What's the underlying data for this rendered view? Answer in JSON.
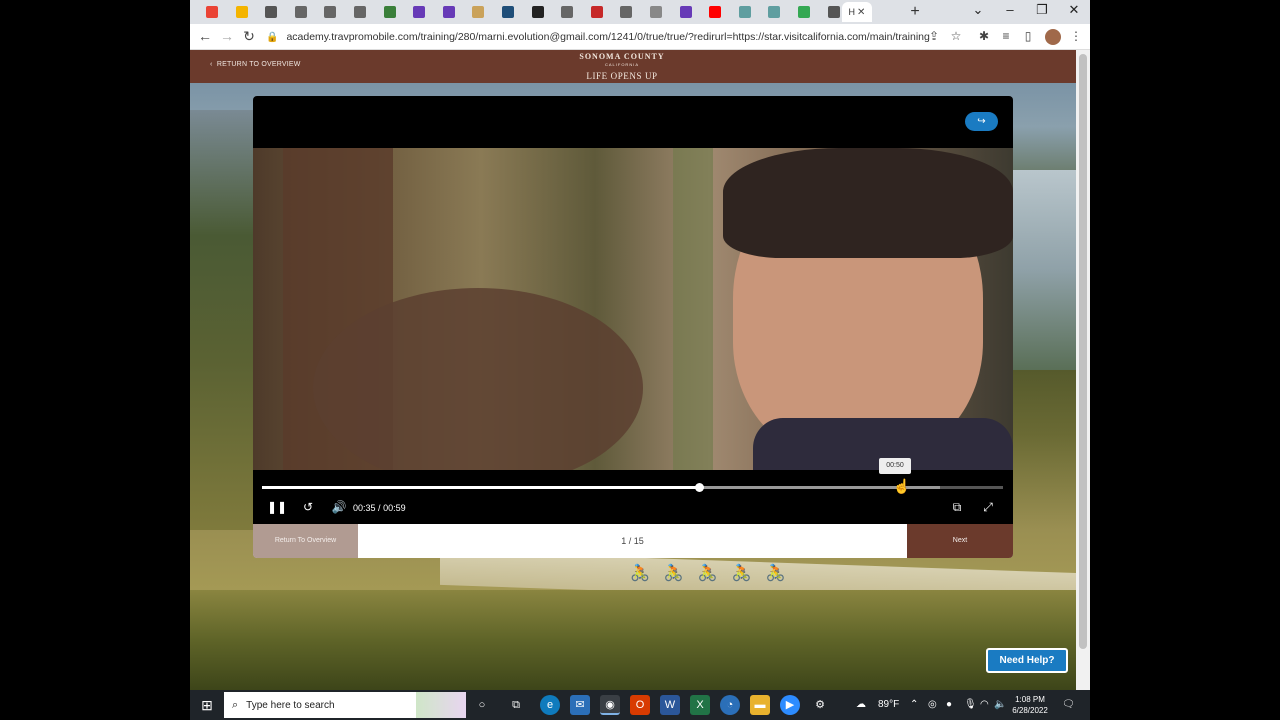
{
  "browser": {
    "tabs": [
      {
        "icon": "gmail-icon",
        "color": "#ea4335"
      },
      {
        "icon": "slides-icon",
        "color": "#f4b400"
      },
      {
        "icon": "web-icon",
        "color": "#555555"
      },
      {
        "icon": "globe-icon",
        "color": "#666666"
      },
      {
        "icon": "globe-icon",
        "color": "#666666"
      },
      {
        "icon": "globe-icon",
        "color": "#666666"
      },
      {
        "icon": "web-icon",
        "color": "#3a7f3a"
      },
      {
        "icon": "forms-icon",
        "color": "#673ab7"
      },
      {
        "icon": "forms-icon",
        "color": "#673ab7"
      },
      {
        "icon": "web-icon",
        "color": "#caa25a"
      },
      {
        "icon": "web-icon",
        "color": "#1f4e79"
      },
      {
        "icon": "web-icon",
        "color": "#222222"
      },
      {
        "icon": "globe-icon",
        "color": "#666666"
      },
      {
        "icon": "web-icon",
        "color": "#c62828"
      },
      {
        "icon": "globe-icon",
        "color": "#666666"
      },
      {
        "icon": "web-icon",
        "color": "#888888"
      },
      {
        "icon": "forms-icon",
        "color": "#673ab7"
      },
      {
        "icon": "youtube-icon",
        "color": "#ff0000"
      },
      {
        "icon": "loading-icon",
        "color": "#5f9ea0"
      },
      {
        "icon": "loading-icon",
        "color": "#5f9ea0"
      },
      {
        "icon": "web-icon",
        "color": "#34a853"
      },
      {
        "icon": "globe-icon",
        "color": "#555555"
      }
    ],
    "active_tab_label": "H",
    "url": "academy.travpromobile.com/training/280/marni.evolution@gmail.com/1241/0/true/true/?redirurl=https://star.visitcalifornia.com/main/training"
  },
  "site": {
    "return_link": "RETURN TO OVERVIEW",
    "brand_line1": "SONOMA COUNTY",
    "brand_line2": "CALIFORNIA",
    "brand_line3": "LIFE OPENS UP",
    "need_help": "Need Help?"
  },
  "player": {
    "progress": 0.59,
    "buffered": 0.915,
    "hover_time": "00:50",
    "current_time": "00:35",
    "separator": "/",
    "duration": "00:59"
  },
  "modal_footer": {
    "return_label": "Return To Overview",
    "page_indicator": "1 / 15",
    "next_label": "Next"
  },
  "taskbar": {
    "search_placeholder": "Type here to search",
    "weather": "89°F",
    "time": "1:08 PM",
    "date": "6/28/2022"
  },
  "colors": {
    "brand_brown": "#6b3a2c",
    "accent_blue": "#1a7bc2"
  }
}
